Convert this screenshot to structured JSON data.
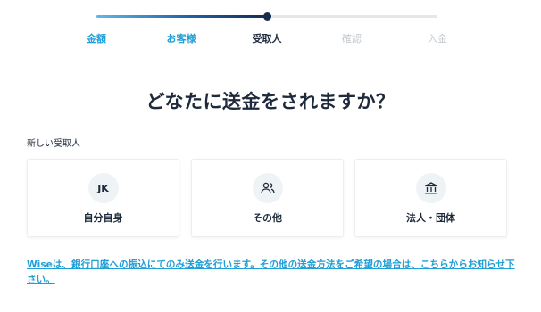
{
  "progress": {
    "fraction": 0.5,
    "steps": [
      {
        "label": "金額",
        "state": "done"
      },
      {
        "label": "お客様",
        "state": "done"
      },
      {
        "label": "受取人",
        "state": "current"
      },
      {
        "label": "確認",
        "state": "todo"
      },
      {
        "label": "入金",
        "state": "todo"
      }
    ]
  },
  "main": {
    "title": "どなたに送金をされますか？",
    "section_label": "新しい受取人",
    "cards": [
      {
        "initials": "JK",
        "label": "自分自身",
        "icon": "initials-avatar"
      },
      {
        "label": "その他",
        "icon": "people-icon"
      },
      {
        "label": "法人・団体",
        "icon": "bank-icon"
      }
    ],
    "info_link": "Wiseは、銀行口座への振込にてのみ送金を行います。その他の送金方法をご希望の場合は、こちらからお知らせ下さい。"
  },
  "colors": {
    "accent": "#1f9fd6",
    "navy": "#162d4f",
    "text": "#1e2a3b",
    "muted": "#c3c8cd"
  }
}
